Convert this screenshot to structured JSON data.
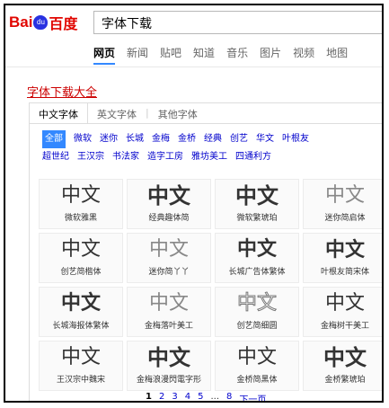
{
  "logo": {
    "bai": "Bai",
    "paw": "du",
    "du": "百度"
  },
  "search": {
    "value": "字体下载"
  },
  "nav": [
    "网页",
    "新闻",
    "贴吧",
    "知道",
    "音乐",
    "图片",
    "视频",
    "地图"
  ],
  "result_title": "字体下载大全",
  "tabs": [
    "中文字体",
    "英文字体",
    "其他字体"
  ],
  "categories": {
    "row1": [
      "全部",
      "微软",
      "迷你",
      "长城",
      "金梅",
      "金桥",
      "经典",
      "创艺",
      "华文",
      "叶根友"
    ],
    "row2": [
      "超世纪",
      "王汉宗",
      "书法家",
      "造字工房",
      "雅坊美工",
      "四通利方"
    ]
  },
  "fonts": [
    {
      "glyph": "中文",
      "name": "微软雅黑"
    },
    {
      "glyph": "中文",
      "name": "经典趣体简"
    },
    {
      "glyph": "中文",
      "name": "微软繁琥珀"
    },
    {
      "glyph": "中文",
      "name": "迷你简启体"
    },
    {
      "glyph": "中文",
      "name": "创艺简楷体"
    },
    {
      "glyph": "中文",
      "name": "迷你简丫丫"
    },
    {
      "glyph": "中文",
      "name": "长城广告体繁体"
    },
    {
      "glyph": "中文",
      "name": "叶根友简宋体"
    },
    {
      "glyph": "中文",
      "name": "长城海报体繁体"
    },
    {
      "glyph": "中文",
      "name": "金梅落叶美工"
    },
    {
      "glyph": "中文",
      "name": "创艺简细圆"
    },
    {
      "glyph": "中文",
      "name": "金梅树干美工"
    },
    {
      "glyph": "中文",
      "name": "王汉宗中魏宋"
    },
    {
      "glyph": "中文",
      "name": "金梅浪漫閃電字形"
    },
    {
      "glyph": "中文",
      "name": "金桥简黑体"
    },
    {
      "glyph": "中文",
      "name": "金桥繁琥珀"
    }
  ],
  "pager": {
    "pages": [
      "1",
      "2",
      "3",
      "4",
      "5"
    ],
    "dots": "...",
    "last": "8",
    "next": "下一页"
  },
  "colors": {
    "accent": "#3388ff",
    "link": "#0000cc",
    "brand_red": "#e10601",
    "brand_blue": "#2932e1"
  }
}
